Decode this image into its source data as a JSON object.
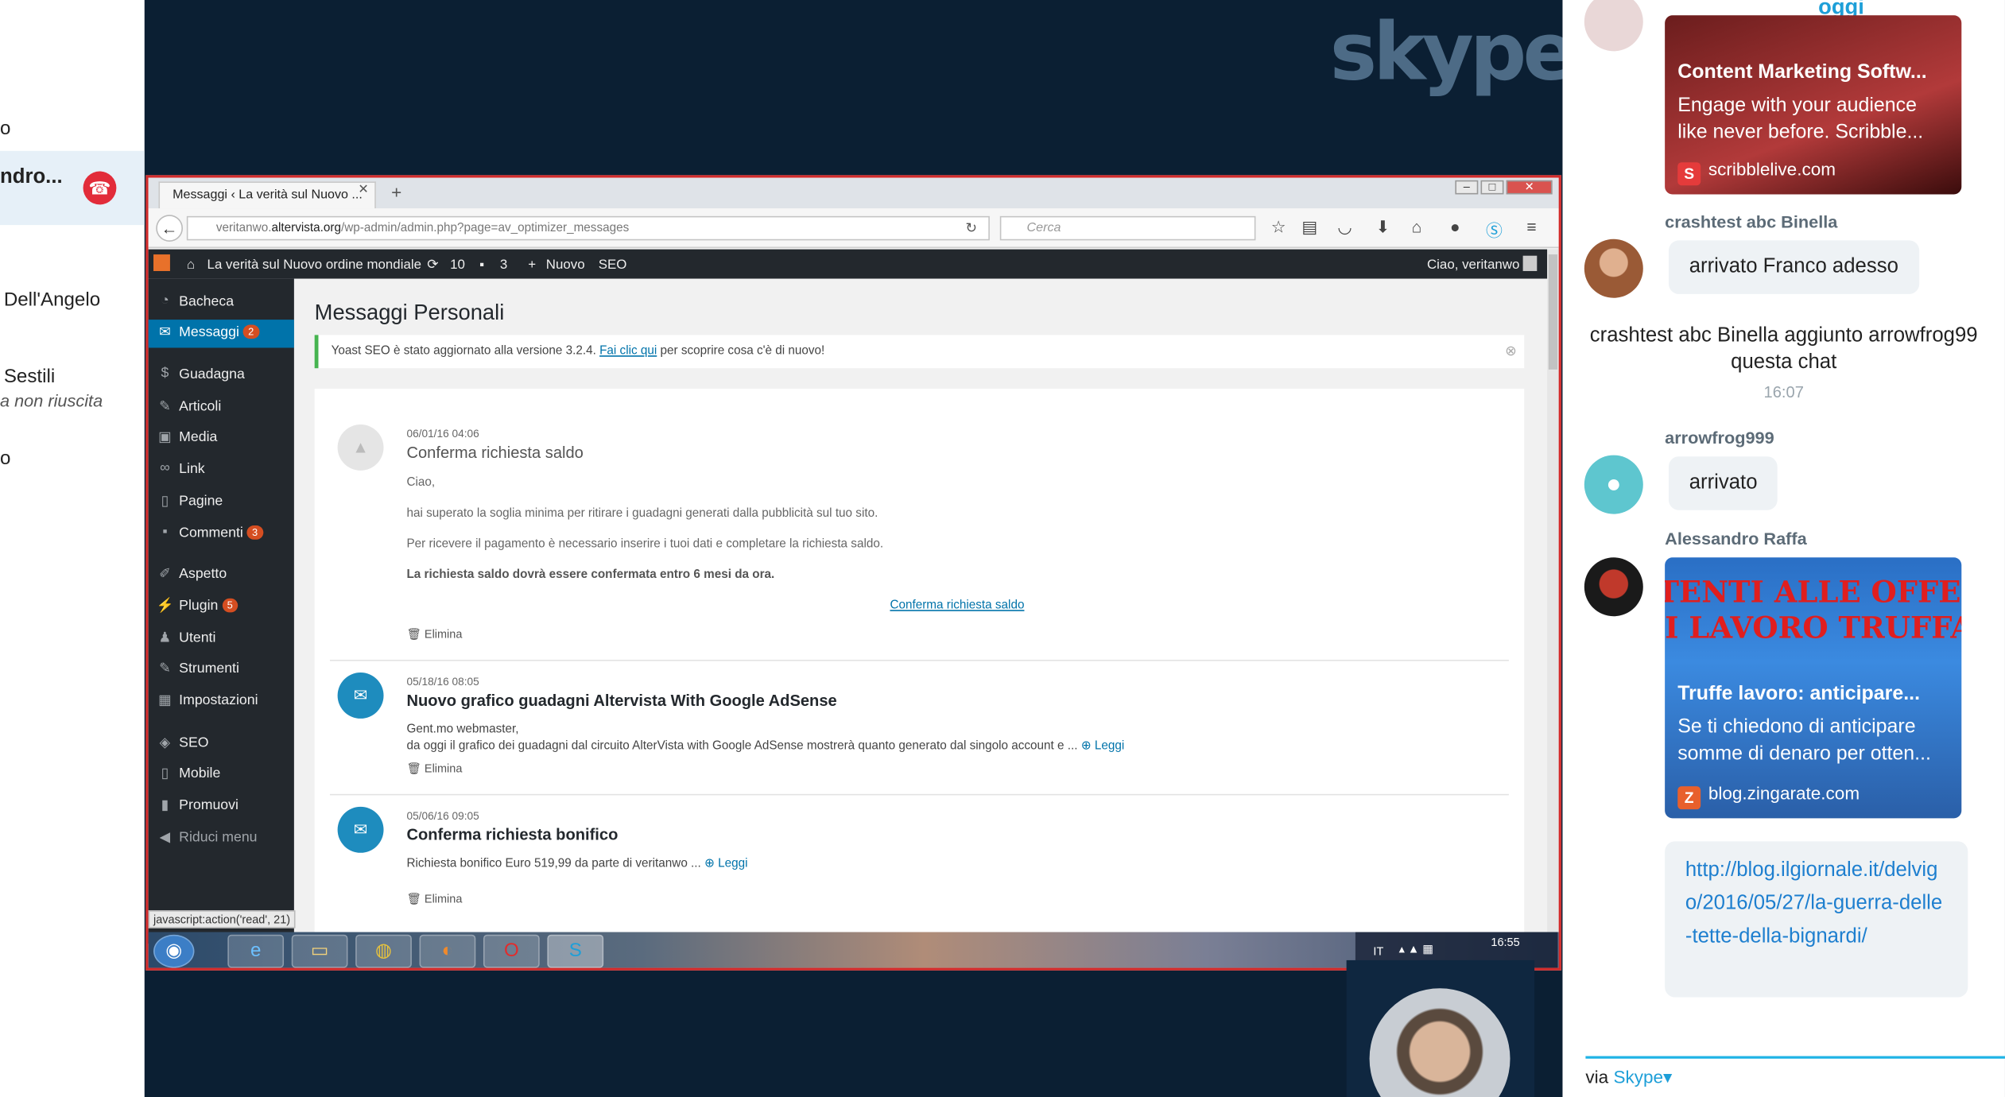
{
  "left_panel": {
    "contacts": [
      {
        "text": "o"
      },
      {
        "text": "ndro..."
      },
      {
        "text": "Dell'Angelo"
      },
      {
        "text": "Sestili",
        "subtitle": "a non riuscita"
      },
      {
        "text": "o"
      }
    ]
  },
  "skype_logo": "skype",
  "browser": {
    "tab_title": "Messaggi ‹ La verità sul Nuovo ...",
    "url_prefix": "veritanwo.",
    "url_domain": "altervista.org",
    "url_path": "/wp-admin/admin.php?page=av_optimizer_messages",
    "search_placeholder": "Cerca"
  },
  "wp_admin_bar": {
    "site_name": "La verità sul Nuovo ordine mondiale",
    "updates": "10",
    "comments": "3",
    "new": "Nuovo",
    "seo": "SEO",
    "greeting": "Ciao, veritanwo"
  },
  "wp_menu": [
    {
      "label": "Bacheca",
      "icon": "dashboard-icon"
    },
    {
      "label": "Messaggi",
      "badge": "2",
      "icon": "mail-icon"
    },
    {
      "label": "Guadagna",
      "icon": "dollar-icon"
    },
    {
      "label": "Articoli",
      "icon": "pin-icon"
    },
    {
      "label": "Media",
      "icon": "media-icon"
    },
    {
      "label": "Link",
      "icon": "link-icon"
    },
    {
      "label": "Pagine",
      "icon": "page-icon"
    },
    {
      "label": "Commenti",
      "badge": "3",
      "icon": "comment-icon"
    },
    {
      "label": "Aspetto",
      "icon": "brush-icon"
    },
    {
      "label": "Plugin",
      "badge": "5",
      "icon": "plugin-icon"
    },
    {
      "label": "Utenti",
      "icon": "user-icon"
    },
    {
      "label": "Strumenti",
      "icon": "wrench-icon"
    },
    {
      "label": "Impostazioni",
      "icon": "settings-icon"
    },
    {
      "label": "SEO",
      "icon": "seo-icon"
    },
    {
      "label": "Mobile",
      "icon": "mobile-icon"
    },
    {
      "label": "Promuovi",
      "icon": "chart-icon"
    },
    {
      "label": "Riduci menu",
      "icon": "collapse-icon"
    }
  ],
  "page": {
    "title": "Messaggi Personali",
    "notice_before": "Yoast SEO è stato aggiornato alla versione 3.2.4.",
    "notice_link": "Fai clic qui",
    "notice_after": "per scoprire cosa c'è di nuovo!"
  },
  "messages": [
    {
      "date": "06/01/16 04:06",
      "title": "Conferma richiesta saldo",
      "lines": [
        "Ciao,",
        "hai superato la soglia minima per ritirare i guadagni generati dalla pubblicità sul tuo sito.",
        "Per ricevere il pagamento è necessario inserire i tuoi dati e completare la richiesta saldo.",
        "La richiesta saldo dovrà essere confermata entro 6 mesi da ora."
      ],
      "action": "Conferma richiesta saldo",
      "delete": "Elimina"
    },
    {
      "date": "05/18/16 08:05",
      "title": "Nuovo grafico guadagni Altervista With Google AdSense",
      "lines": [
        "Gent.mo webmaster,",
        "da oggi il grafico dei guadagni dal circuito AlterVista with Google AdSense mostrerà quanto generato dal singolo account e ..."
      ],
      "read": "Leggi",
      "delete": "Elimina"
    },
    {
      "date": "05/06/16 09:05",
      "title": "Conferma richiesta bonifico",
      "lines": [
        "Richiesta bonifico Euro 519,99 da parte di veritanwo ..."
      ],
      "read": "Leggi",
      "delete": "Elimina"
    }
  ],
  "status_url": "javascript:action('read', 21)",
  "taskbar": {
    "lang": "IT",
    "time": "16:55"
  },
  "chat": {
    "day_label": "oggi",
    "card1": {
      "title": "Content Marketing Softw...",
      "desc": "Engage with your audience like never before. Scribble...",
      "source": "scribblelive.com",
      "source_icon": "S"
    },
    "msg1": {
      "sender": "crashtest abc Binella",
      "text": "arrivato Franco adesso"
    },
    "system": "crashtest abc Binella aggiunto arrowfrog99 questa chat",
    "system_time": "16:07",
    "msg2": {
      "sender": "arrowfrog999",
      "text": "arrivato"
    },
    "msg3": {
      "sender": "Alessandro Raffa"
    },
    "card2": {
      "banner_line1": "TENTI ALLE OFFE",
      "banner_line2": "I LAVORO TRUFFA",
      "title": "Truffe lavoro: anticipare...",
      "desc": "Se ti chiedono di anticipare somme di denaro per otten...",
      "source": "blog.zingarate.com",
      "source_icon": "Z"
    },
    "link": "http://blog.ilgiornale.it/delvigo/2016/05/27/la-guerra-delle-tette-della-bignardi/",
    "via_prefix": "via",
    "via_brand": "Skype▾"
  },
  "colors": {
    "accent": "#0073aa",
    "skype_blue": "#1e9fd8",
    "end_call": "#e22c3a",
    "wp_dark": "#23282d"
  }
}
